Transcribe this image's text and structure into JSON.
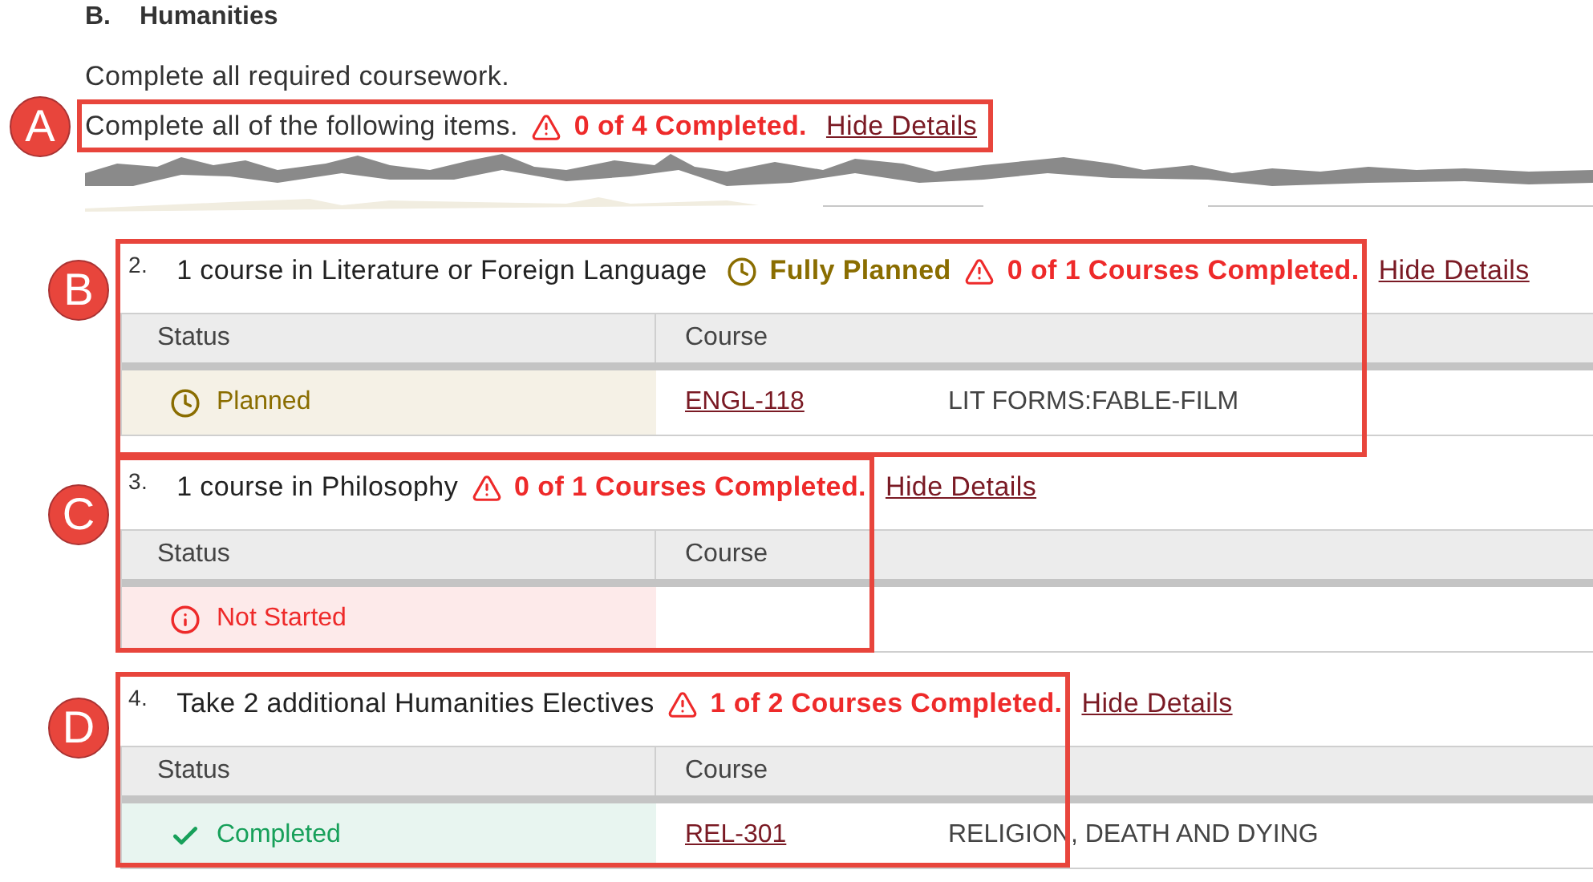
{
  "heading": {
    "letter": "B.",
    "title": "Humanities"
  },
  "intro": "Complete all required coursework.",
  "summary": {
    "text": "Complete all of the following items.",
    "status": "0 of 4 Completed.",
    "link": "Hide Details"
  },
  "sections": [
    {
      "number": "2.",
      "title": "1 course in Literature or Foreign Language",
      "planned": "Fully Planned",
      "status": "0 of 1 Courses Completed.",
      "link": "Hide Details",
      "columns": [
        "Status",
        "Course"
      ],
      "rows": [
        {
          "kind": "planned",
          "status": "Planned",
          "course": "ENGL-118",
          "course_title": "LIT FORMS:FABLE-FILM"
        }
      ]
    },
    {
      "number": "3.",
      "title": "1 course in Philosophy",
      "status": "0 of 1 Courses Completed.",
      "link": "Hide Details",
      "columns": [
        "Status",
        "Course"
      ],
      "rows": [
        {
          "kind": "not_started",
          "status": "Not Started"
        }
      ]
    },
    {
      "number": "4.",
      "title": "Take 2 additional Humanities Electives",
      "status": "1 of 2 Courses Completed.",
      "link": "Hide Details",
      "columns": [
        "Status",
        "Course"
      ],
      "rows": [
        {
          "kind": "completed",
          "status": "Completed",
          "course": "REL-301",
          "course_title": "RELIGION, DEATH AND DYING"
        }
      ]
    }
  ],
  "callouts": [
    {
      "label": "A"
    },
    {
      "label": "B"
    },
    {
      "label": "C"
    },
    {
      "label": "D"
    }
  ]
}
